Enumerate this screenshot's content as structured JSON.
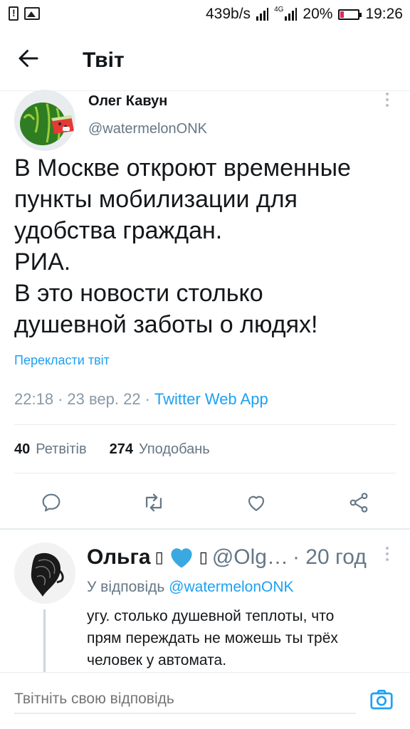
{
  "status_bar": {
    "speed": "439b/s",
    "network": "4G",
    "battery": "20%",
    "time": "19:26"
  },
  "header": {
    "title": "Твіт"
  },
  "tweet": {
    "author_name": "Олег Кавун",
    "author_handle": "@watermelonONK",
    "text_lines": [
      "В Москве откроют временные",
      "пункты мобилизации для",
      "удобства граждан.",
      "РИА.",
      "В это новости столько",
      "душевной заботы о людях!"
    ],
    "translate_label": "Перекласти твіт",
    "time": "22:18",
    "date": "23 вер. 22",
    "source": "Twitter Web App",
    "retweets_count": "40",
    "retweets_label": "Ретвітів",
    "likes_count": "274",
    "likes_label": "Уподобань"
  },
  "actions": {
    "reply_icon": "reply-icon",
    "retweet_icon": "retweet-icon",
    "like_icon": "heart-icon",
    "share_icon": "share-icon"
  },
  "reply": {
    "name": "Ольга",
    "emoji_left": "▯",
    "emoji_right": "▯",
    "handle": "@Olg…",
    "time": "· 20 год",
    "reply_to_label": "У відповідь",
    "reply_to_handle": "@watermelonONK",
    "text_lines": [
      "угу. столько душевной теплоты, что",
      "прям переждать не можешь ты трёх",
      "человек у автомата."
    ]
  },
  "compose": {
    "placeholder": "Твітніть свою відповідь"
  },
  "colors": {
    "accent": "#1da1f2",
    "text": "#14171a",
    "secondary": "#657786",
    "heart": "#3aa9e0"
  }
}
